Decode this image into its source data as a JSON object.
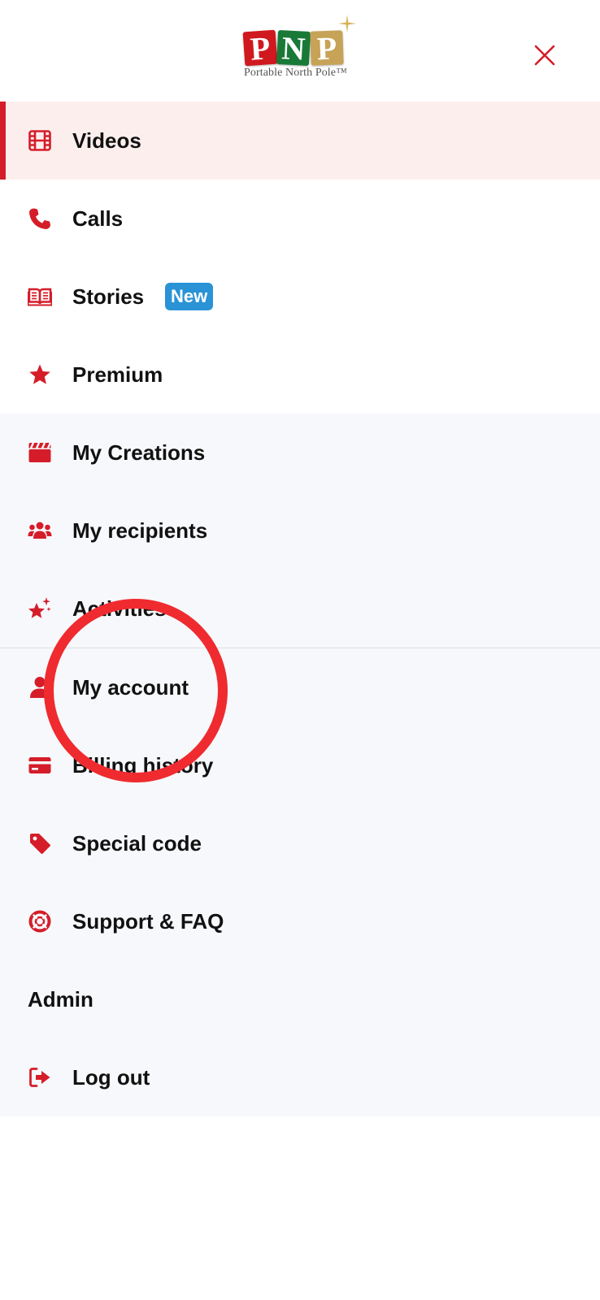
{
  "header": {
    "logo_letters": [
      "P",
      "N",
      "P"
    ],
    "logo_subtitle": "Portable North Pole™",
    "close_icon": "close-icon"
  },
  "menu": {
    "primary": [
      {
        "label": "Videos",
        "icon": "film-icon",
        "active": true
      },
      {
        "label": "Calls",
        "icon": "phone-icon"
      },
      {
        "label": "Stories",
        "icon": "book-icon",
        "badge": "New"
      },
      {
        "label": "Premium",
        "icon": "star-icon"
      }
    ],
    "secondary": [
      {
        "label": "My Creations",
        "icon": "clapperboard-icon"
      },
      {
        "label": "My recipients",
        "icon": "users-icon"
      },
      {
        "label": "Activities",
        "icon": "sparkle-star-icon"
      }
    ],
    "account": [
      {
        "label": "My account",
        "icon": "user-icon"
      },
      {
        "label": "Billing history",
        "icon": "credit-card-icon"
      },
      {
        "label": "Special code",
        "icon": "tag-icon"
      },
      {
        "label": "Support & FAQ",
        "icon": "lifebuoy-icon"
      },
      {
        "label": "Admin"
      },
      {
        "label": "Log out",
        "icon": "logout-icon"
      }
    ]
  },
  "colors": {
    "accent": "#d51d2a",
    "active_bg": "#fdeeee",
    "section_bg": "#f7f8fb",
    "badge": "#2a93d6",
    "highlight_circle": "#ef2b30"
  }
}
